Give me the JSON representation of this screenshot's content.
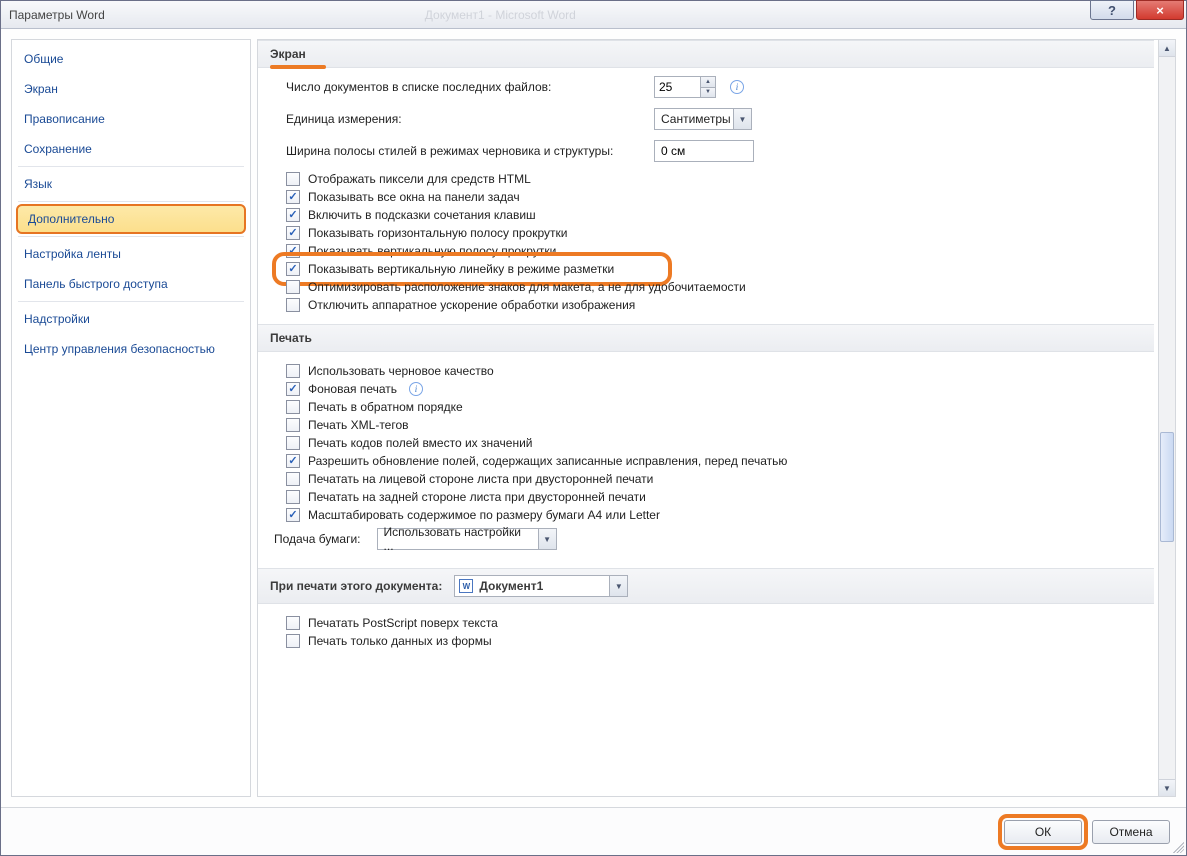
{
  "window": {
    "title": "Параметры Word",
    "ghost_center": "Документ1 - Microsoft Word",
    "help_tooltip": "?",
    "close_tooltip": "×"
  },
  "sidebar": {
    "items": [
      {
        "label": "Общие"
      },
      {
        "label": "Экран"
      },
      {
        "label": "Правописание"
      },
      {
        "label": "Сохранение"
      },
      {
        "label": "Язык"
      },
      {
        "label": "Дополнительно",
        "selected": true
      },
      {
        "label": "Настройка ленты"
      },
      {
        "label": "Панель быстрого доступа"
      },
      {
        "label": "Надстройки"
      },
      {
        "label": "Центр управления безопасностью"
      }
    ]
  },
  "sections": {
    "screen": {
      "title": "Экран",
      "recent_docs_label": "Число документов в списке последних файлов:",
      "recent_docs_value": "25",
      "units_label": "Единица измерения:",
      "units_value": "Сантиметры",
      "style_width_label": "Ширина полосы стилей в режимах черновика и структуры:",
      "style_width_value": "0 см",
      "checkboxes": [
        {
          "label": "Отображать пиксели для средств HTML",
          "checked": false
        },
        {
          "label": "Показывать все окна на панели задач",
          "checked": true
        },
        {
          "label": "Включить в подсказки сочетания клавиш",
          "checked": true
        },
        {
          "label": "Показывать горизонтальную полосу прокрутки",
          "checked": true
        },
        {
          "label": "Показывать вертикальную полосу прокрутки",
          "checked": true
        },
        {
          "label": "Показывать вертикальную линейку в режиме разметки",
          "checked": true,
          "highlighted": true
        },
        {
          "label": "Оптимизировать расположение знаков для макета, а не для удобочитаемости",
          "checked": false
        },
        {
          "label": "Отключить аппаратное ускорение обработки изображения",
          "checked": false
        }
      ]
    },
    "print": {
      "title": "Печать",
      "checkboxes": [
        {
          "label": "Использовать черновое качество",
          "checked": false
        },
        {
          "label": "Фоновая печать",
          "checked": true,
          "info": true
        },
        {
          "label": "Печать в обратном порядке",
          "checked": false
        },
        {
          "label": "Печать XML-тегов",
          "checked": false
        },
        {
          "label": "Печать кодов полей вместо их значений",
          "checked": false
        },
        {
          "label": "Разрешить обновление полей, содержащих записанные исправления, перед печатью",
          "checked": true
        },
        {
          "label": "Печатать на лицевой стороне листа при двусторонней печати",
          "checked": false
        },
        {
          "label": "Печатать на задней стороне листа при двусторонней печати",
          "checked": false
        },
        {
          "label": "Масштабировать содержимое по размеру бумаги A4 или Letter",
          "checked": true
        }
      ],
      "paper_feed_label": "Подача бумаги:",
      "paper_feed_value": "Использовать настройки ..."
    },
    "print_doc": {
      "title": "При печати этого документа:",
      "doc_name": "Документ1",
      "checkboxes": [
        {
          "label": "Печатать PostScript поверх текста",
          "checked": false
        },
        {
          "label": "Печать только данных из формы",
          "checked": false
        }
      ]
    }
  },
  "footer": {
    "ok": "ОК",
    "cancel": "Отмена"
  }
}
